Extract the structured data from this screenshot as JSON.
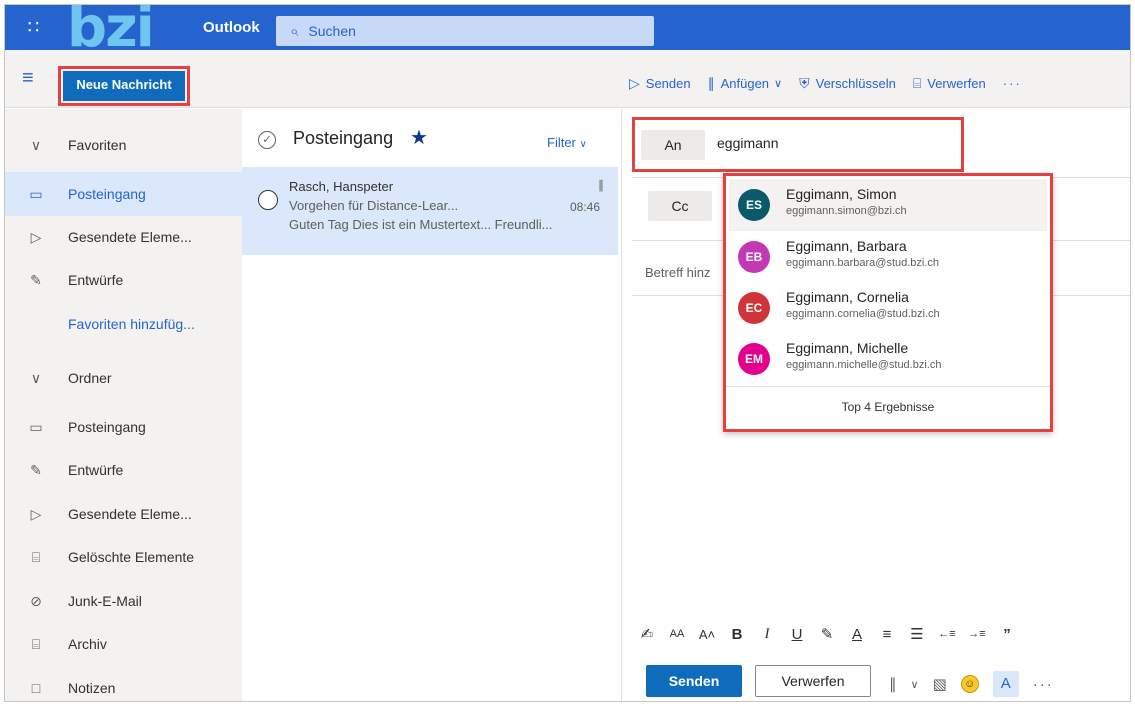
{
  "topbar": {
    "waffle_icon": "waffle-icon",
    "logo_text": "bzi",
    "app_name": "Outlook",
    "search_placeholder": "Suchen"
  },
  "cmdbar": {
    "new_message": "Neue Nachricht",
    "send": "Senden",
    "attach": "Anfügen",
    "encrypt": "Verschlüsseln",
    "discard": "Verwerfen",
    "more": "···"
  },
  "nav": {
    "favorites_header": "Favoriten",
    "favorites": [
      "Posteingang",
      "Gesendete Eleme...",
      "Entwürfe"
    ],
    "add_favorites": "Favoriten hinzufüg...",
    "folders_header": "Ordner",
    "folders": [
      "Posteingang",
      "Entwürfe",
      "Gesendete Eleme...",
      "Gelöschte Elemente",
      "Junk-E-Mail",
      "Archiv",
      "Notizen"
    ]
  },
  "msglist": {
    "title": "Posteingang",
    "filter": "Filter",
    "message": {
      "from": "Rasch, Hanspeter",
      "subject": "Vorgehen für Distance-Lear...",
      "time": "08:46",
      "preview": "Guten Tag Dies ist ein Mustertext... Freundli..."
    }
  },
  "compose": {
    "to_label": "An",
    "to_value": "eggimann",
    "cc_label": "Cc",
    "subject_placeholder": "Betreff hinz",
    "send_button": "Senden",
    "discard_button": "Verwerfen"
  },
  "suggestions": {
    "items": [
      {
        "initials": "ES",
        "name": "Eggimann, Simon",
        "email": "eggimann.simon@bzi.ch",
        "color": "#0b5a6b"
      },
      {
        "initials": "EB",
        "name": "Eggimann, Barbara",
        "email": "eggimann.barbara@stud.bzi.ch",
        "color": "#c239b3"
      },
      {
        "initials": "EC",
        "name": "Eggimann, Cornelia",
        "email": "eggimann.cornelia@stud.bzi.ch",
        "color": "#d13438"
      },
      {
        "initials": "EM",
        "name": "Eggimann, Michelle",
        "email": "eggimann.michelle@stud.bzi.ch",
        "color": "#e3008c"
      }
    ],
    "footer": "Top 4 Ergebnisse"
  },
  "colors": {
    "accent": "#2564cf",
    "highlight_box": "#e53f3f",
    "selected_bg": "#dbe7fa"
  }
}
